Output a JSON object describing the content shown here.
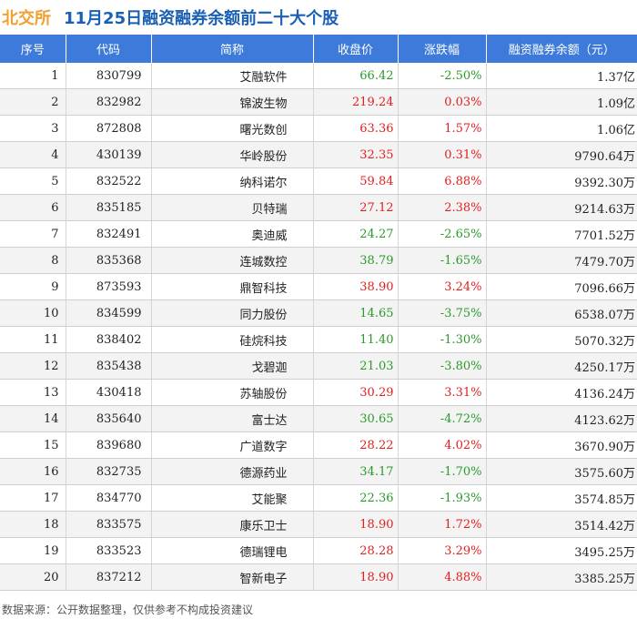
{
  "header": {
    "brand": "北交所",
    "title": "11月25日融资融券余额前二十大个股"
  },
  "chart_data": {
    "type": "table",
    "columns": [
      "序号",
      "代码",
      "简称",
      "收盘价",
      "涨跌幅",
      "融资融券余额（元）"
    ],
    "rows": [
      {
        "rank": "1",
        "code": "830799",
        "name": "艾融软件",
        "price": "66.42",
        "change": "-2.50%",
        "balance": "1.37亿"
      },
      {
        "rank": "2",
        "code": "832982",
        "name": "锦波生物",
        "price": "219.24",
        "change": "0.03%",
        "balance": "1.09亿"
      },
      {
        "rank": "3",
        "code": "872808",
        "name": "曙光数创",
        "price": "63.36",
        "change": "1.57%",
        "balance": "1.06亿"
      },
      {
        "rank": "4",
        "code": "430139",
        "name": "华岭股份",
        "price": "32.35",
        "change": "0.31%",
        "balance": "9790.64万"
      },
      {
        "rank": "5",
        "code": "832522",
        "name": "纳科诺尔",
        "price": "59.84",
        "change": "6.88%",
        "balance": "9392.30万"
      },
      {
        "rank": "6",
        "code": "835185",
        "name": "贝特瑞",
        "price": "27.12",
        "change": "2.38%",
        "balance": "9214.63万"
      },
      {
        "rank": "7",
        "code": "832491",
        "name": "奥迪威",
        "price": "24.27",
        "change": "-2.65%",
        "balance": "7701.52万"
      },
      {
        "rank": "8",
        "code": "835368",
        "name": "连城数控",
        "price": "38.79",
        "change": "-1.65%",
        "balance": "7479.70万"
      },
      {
        "rank": "9",
        "code": "873593",
        "name": "鼎智科技",
        "price": "38.90",
        "change": "3.24%",
        "balance": "7096.66万"
      },
      {
        "rank": "10",
        "code": "834599",
        "name": "同力股份",
        "price": "14.65",
        "change": "-3.75%",
        "balance": "6538.07万"
      },
      {
        "rank": "11",
        "code": "838402",
        "name": "硅烷科技",
        "price": "11.40",
        "change": "-1.30%",
        "balance": "5070.32万"
      },
      {
        "rank": "12",
        "code": "835438",
        "name": "戈碧迦",
        "price": "21.03",
        "change": "-3.80%",
        "balance": "4250.17万"
      },
      {
        "rank": "13",
        "code": "430418",
        "name": "苏轴股份",
        "price": "30.29",
        "change": "3.31%",
        "balance": "4136.24万"
      },
      {
        "rank": "14",
        "code": "835640",
        "name": "富士达",
        "price": "30.65",
        "change": "-4.72%",
        "balance": "4123.62万"
      },
      {
        "rank": "15",
        "code": "839680",
        "name": "广道数字",
        "price": "28.22",
        "change": "4.02%",
        "balance": "3670.90万"
      },
      {
        "rank": "16",
        "code": "832735",
        "name": "德源药业",
        "price": "34.17",
        "change": "-1.70%",
        "balance": "3575.60万"
      },
      {
        "rank": "17",
        "code": "834770",
        "name": "艾能聚",
        "price": "22.36",
        "change": "-1.93%",
        "balance": "3574.85万"
      },
      {
        "rank": "18",
        "code": "833575",
        "name": "康乐卫士",
        "price": "18.90",
        "change": "1.72%",
        "balance": "3514.42万"
      },
      {
        "rank": "19",
        "code": "833523",
        "name": "德瑞锂电",
        "price": "28.28",
        "change": "3.29%",
        "balance": "3495.25万"
      },
      {
        "rank": "20",
        "code": "837212",
        "name": "智新电子",
        "price": "18.90",
        "change": "4.88%",
        "balance": "3385.25万"
      }
    ]
  },
  "colors": {
    "header_bg": "#3d7ad9",
    "brand": "#f0a030",
    "title": "#1a5fb4",
    "up": "#e02020",
    "down": "#2a9a2a"
  },
  "footer": "数据来源：公开数据整理，仅供参考不构成投资建议"
}
